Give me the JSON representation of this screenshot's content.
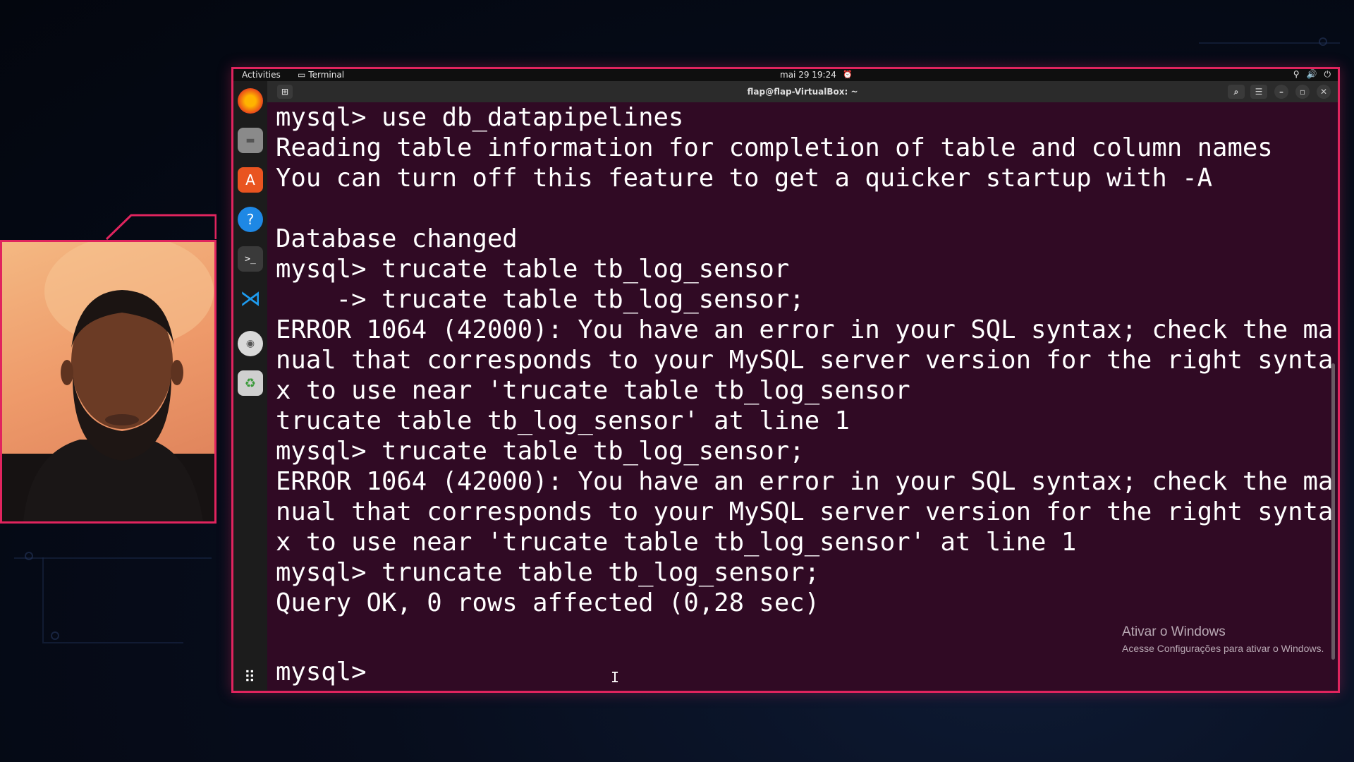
{
  "topbar": {
    "activities": "Activities",
    "app": "Terminal",
    "clock": "mai 29  19:24"
  },
  "window": {
    "title": "flap@flap-VirtualBox: ~"
  },
  "dock": [
    "firefox-icon",
    "files-icon",
    "software-icon",
    "help-icon",
    "terminal-icon",
    "vscode-icon",
    "disc-icon",
    "trash-icon"
  ],
  "terminal": {
    "lines": [
      "mysql> use db_datapipelines",
      "Reading table information for completion of table and column names",
      "You can turn off this feature to get a quicker startup with -A",
      "",
      "Database changed",
      "mysql> trucate table tb_log_sensor",
      "    -> trucate table tb_log_sensor;",
      "ERROR 1064 (42000): You have an error in your SQL syntax; check the ma",
      "nual that corresponds to your MySQL server version for the right synta",
      "x to use near 'trucate table tb_log_sensor",
      "trucate table tb_log_sensor' at line 1",
      "mysql> trucate table tb_log_sensor;",
      "ERROR 1064 (42000): You have an error in your SQL syntax; check the ma",
      "nual that corresponds to your MySQL server version for the right synta",
      "x to use near 'trucate table tb_log_sensor' at line 1",
      "mysql> truncate table tb_log_sensor;",
      "Query OK, 0 rows affected (0,28 sec)",
      "",
      "mysql> "
    ]
  },
  "watermark": {
    "line1": "Ativar o Windows",
    "line2": "Acesse Configurações para ativar o Windows."
  },
  "colors": {
    "accent": "#e0245e",
    "terminal_bg": "#300a24"
  }
}
